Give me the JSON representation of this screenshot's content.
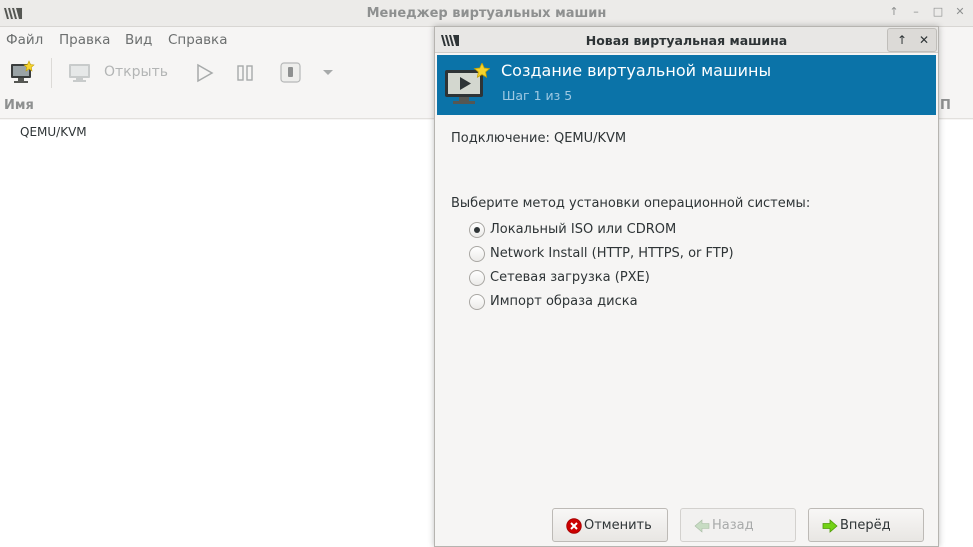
{
  "main_window": {
    "title": "Менеджер виртуальных машин",
    "wm_buttons": [
      "↑",
      "–",
      "□",
      "✕"
    ],
    "menu": [
      "Файл",
      "Правка",
      "Вид",
      "Справка"
    ],
    "toolbar": {
      "open_label": "Открыть"
    },
    "list": {
      "columns": [
        "Имя",
        "П"
      ],
      "rows": [
        "QEMU/KVM"
      ]
    }
  },
  "dialog": {
    "title": "Новая виртуальная машина",
    "wm_buttons": [
      "↑",
      "✕"
    ],
    "banner": {
      "title": "Создание виртуальной машины",
      "step": "Шаг 1 из 5"
    },
    "connection": "Подключение: QEMU/KVM",
    "method_prompt": "Выберите метод установки операционной системы:",
    "options": [
      {
        "label": "Локальный ISO или CDROM",
        "selected": true
      },
      {
        "label": "Network Install (HTTP, HTTPS, or FTP)",
        "selected": false
      },
      {
        "label": "Сетевая загрузка (PXE)",
        "selected": false
      },
      {
        "label": "Импорт образа диска",
        "selected": false
      }
    ],
    "buttons": {
      "cancel": "Отменить",
      "back": "Назад",
      "forward": "Вперёд"
    }
  },
  "colors": {
    "banner": "#0b73a8",
    "banner_subtitle": "#9fc9e2",
    "disabled_text": "#a8aaaa"
  }
}
